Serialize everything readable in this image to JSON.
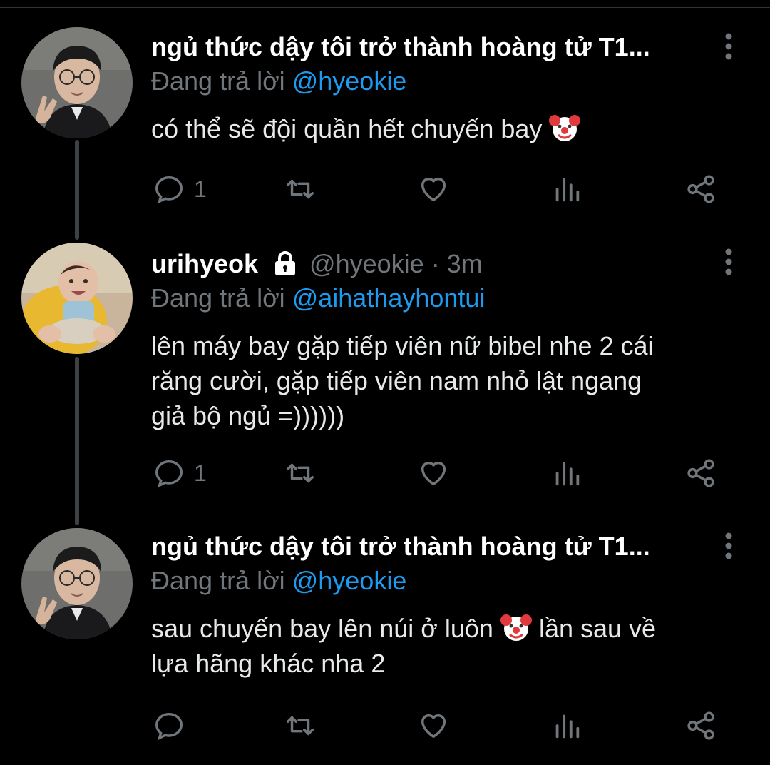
{
  "tweets": [
    {
      "author_name": "ngủ thức dậy tôi trở thành hoàng tử T1...",
      "reply_prefix": "Đang trả lời",
      "reply_to": "@hyeokie",
      "text": "có thể sẽ đội quần hết chuyến bay",
      "reply_count": "1",
      "avatar": "person-avatar"
    },
    {
      "author_name": "urihyeok",
      "protected_icon": "lock-icon",
      "handle": "@hyeokie",
      "time": "· 3m",
      "reply_prefix": "Đang trả lời",
      "reply_to": "@aihathayhontui",
      "text_lines": [
        "lên máy bay gặp tiếp viên nữ bibel nhe 2 cái",
        "răng cười, gặp tiếp viên nam nhỏ lật ngang",
        "giả bộ ngủ =))))))"
      ],
      "reply_count": "1",
      "avatar": "baby-avatar"
    },
    {
      "author_name": "ngủ thức dậy tôi trở thành hoàng tử T1...",
      "reply_prefix": "Đang trả lời",
      "reply_to": "@hyeokie",
      "text_part1": "sau chuyến bay lên núi ở luôn",
      "text_part2": "lần sau về",
      "text_line2": "lựa hãng khác nha 2",
      "reply_count": "",
      "avatar": "person-avatar"
    }
  ],
  "icons": [
    "reply-icon",
    "retweet-icon",
    "like-icon",
    "views-icon",
    "share-icon",
    "more-icon",
    "clown-emoji"
  ],
  "colors": {
    "background": "#000000",
    "muted": "#71767b",
    "link": "#1d9bf0",
    "text": "#e7e9ea"
  }
}
